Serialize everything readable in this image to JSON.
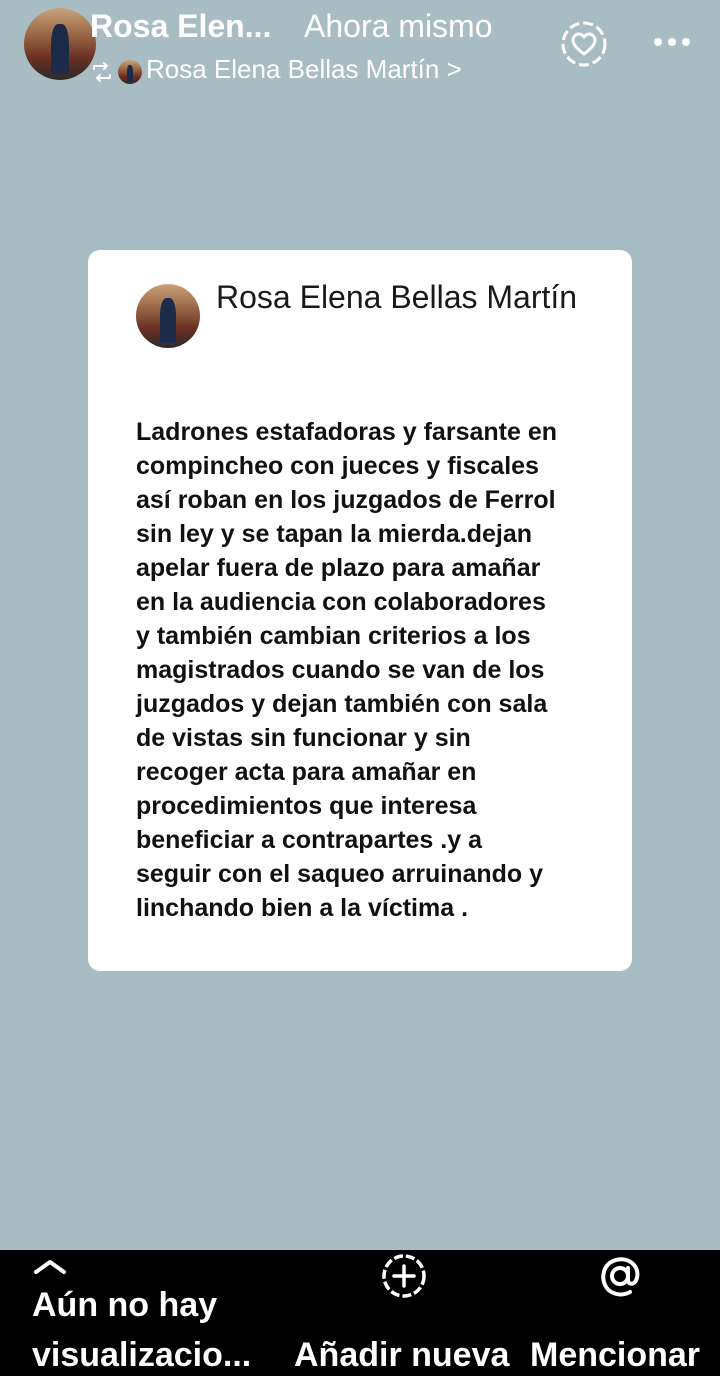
{
  "header": {
    "author_short": "Rosa Elen...",
    "time": "Ahora mismo",
    "shared_from": "Rosa Elena Bellas Martín >",
    "icons": {
      "reshare": "reshare-icon",
      "reaction": "heart-icon",
      "menu": "more-icon"
    }
  },
  "card": {
    "author": "Rosa Elena Bellas Martín",
    "text": "Ladrones estafadoras y farsante en\ncompincheo con jueces y fiscales\nasí roban en los juzgados de Ferrol\nsin ley y se tapan la mierda.dejan\napelar fuera de plazo para amañar\nen la audiencia con colaboradores\ny también cambian criterios a los\nmagistrados cuando se van de los\njuzgados y dejan también con sala\nde vistas sin funcionar y sin\nrecoger acta para amañar en\nprocedimientos que interesa\nbeneficiar a contrapartes .y a\nseguir con el saqueo arruinando y\nlinchando bien a la víctima ."
  },
  "bottom": {
    "views_label": "Aún no hay visualizacio...",
    "add_label": "Añadir nueva",
    "mention_label": "Mencionar"
  },
  "colors": {
    "story_background": "#a8bcc3",
    "card_background": "#ffffff",
    "bottom_bar": "#000000"
  }
}
